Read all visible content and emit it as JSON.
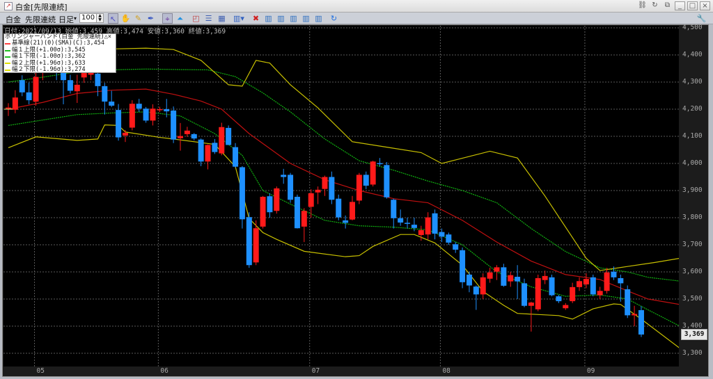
{
  "window": {
    "title": "白金[先限連続]"
  },
  "toolbar": {
    "commodity": "白金",
    "contract": "先限連続",
    "period": "日足",
    "period_arrow": "▾",
    "bar_count": "100"
  },
  "info_line": "日付:2021/09/13 始値:3,459 高値:3,474 安値:3,360 終値:3,369",
  "legend": {
    "title": "ボリンジャーバンド(白金 先限連続)△×",
    "items": [
      {
        "label": "基準線(21)(0)(SMA)(C):3,454",
        "color": "#ff4040"
      },
      {
        "label": "幅１上限(+1.00σ):3,545",
        "color": "#20c020"
      },
      {
        "label": "幅１下限(-1.00σ):3,362",
        "color": "#20c020"
      },
      {
        "label": "幅２上限(+1.96σ):3,633",
        "color": "#e0e000"
      },
      {
        "label": "幅２下限(-1.96σ):3,274",
        "color": "#e0e000"
      }
    ]
  },
  "last_price": "3,369",
  "chart_data": {
    "type": "candlestick",
    "title": "白金[先限連続] 日足",
    "ylim": [
      3250,
      4500
    ],
    "y_ticks": [
      "4,500",
      "4,400",
      "4,300",
      "4,200",
      "4,100",
      "4,000",
      "3,900",
      "3,800",
      "3,700",
      "3,600",
      "3,500",
      "3,400",
      "3,300"
    ],
    "y_tick_values": [
      4500,
      4400,
      4300,
      4200,
      4100,
      4000,
      3900,
      3800,
      3700,
      3600,
      3500,
      3400,
      3300
    ],
    "x_months": [
      {
        "label": "05",
        "index": 4
      },
      {
        "label": "06",
        "index": 22
      },
      {
        "label": "07",
        "index": 44
      },
      {
        "label": "08",
        "index": 63
      },
      {
        "label": "09",
        "index": 84
      }
    ],
    "colors": {
      "up": "#ff1a1a",
      "down": "#1e90ff",
      "mid": "#c01010",
      "band1": "#10b010",
      "band2": "#c8c000"
    },
    "ohlc": [
      [
        4202,
        4222,
        4175,
        4206
      ],
      [
        4198,
        4270,
        4185,
        4243
      ],
      [
        4307,
        4325,
        4248,
        4262
      ],
      [
        4262,
        4298,
        4218,
        4233
      ],
      [
        4228,
        4337,
        4213,
        4319
      ],
      [
        4336,
        4386,
        4307,
        4366
      ],
      [
        4366,
        4405,
        4336,
        4351
      ],
      [
        4351,
        4376,
        4307,
        4336
      ],
      [
        4346,
        4356,
        4218,
        4307
      ],
      [
        4307,
        4327,
        4258,
        4268
      ],
      [
        4266,
        4327,
        4223,
        4290
      ],
      [
        4317,
        4351,
        4297,
        4336
      ],
      [
        4327,
        4341,
        4307,
        4336
      ],
      [
        4331,
        4346,
        4248,
        4285
      ],
      [
        4285,
        4297,
        4180,
        4228
      ],
      [
        4228,
        4268,
        4208,
        4213
      ],
      [
        4197,
        4219,
        4084,
        4096
      ],
      [
        4103,
        4123,
        4079,
        4113
      ],
      [
        4132,
        4233,
        4122,
        4220
      ],
      [
        4220,
        4238,
        4190,
        4202
      ],
      [
        4202,
        4208,
        4150,
        4158
      ],
      [
        4158,
        4218,
        4140,
        4202
      ],
      [
        4197,
        4209,
        4189,
        4200
      ],
      [
        4200,
        4238,
        4170,
        4192
      ],
      [
        4195,
        4210,
        4075,
        4088
      ],
      [
        4093,
        4149,
        4047,
        4101
      ],
      [
        4108,
        4135,
        4098,
        4121
      ],
      [
        4108,
        4112,
        4085,
        4092
      ],
      [
        4088,
        4092,
        3990,
        4007
      ],
      [
        4007,
        4070,
        3978,
        4068
      ],
      [
        4076,
        4090,
        4035,
        4042
      ],
      [
        4037,
        4150,
        4030,
        4134
      ],
      [
        4131,
        4140,
        4068,
        4068
      ],
      [
        4060,
        4075,
        3985,
        3988
      ],
      [
        3986,
        3990,
        3760,
        3794
      ],
      [
        3802,
        3820,
        3615,
        3625
      ],
      [
        3635,
        3790,
        3625,
        3761
      ],
      [
        3767,
        3880,
        3760,
        3877
      ],
      [
        3879,
        3890,
        3800,
        3820
      ],
      [
        3825,
        3915,
        3815,
        3908
      ],
      [
        3958,
        3980,
        3925,
        3950
      ],
      [
        3958,
        3965,
        3855,
        3866
      ],
      [
        3877,
        3885,
        3760,
        3761
      ],
      [
        3767,
        3835,
        3710,
        3825
      ],
      [
        3840,
        3905,
        3800,
        3890
      ],
      [
        3893,
        3915,
        3850,
        3903
      ],
      [
        3906,
        3955,
        3880,
        3950
      ],
      [
        3950,
        3970,
        3850,
        3866
      ],
      [
        3870,
        3885,
        3790,
        3801
      ],
      [
        3790,
        3808,
        3760,
        3781
      ],
      [
        3793,
        3880,
        3790,
        3858
      ],
      [
        3863,
        3965,
        3850,
        3958
      ],
      [
        3958,
        3970,
        3905,
        3918
      ],
      [
        3922,
        4010,
        3915,
        4007
      ],
      [
        4001,
        4020,
        3990,
        4000
      ],
      [
        3994,
        4005,
        3870,
        3875
      ],
      [
        3866,
        3870,
        3760,
        3798
      ],
      [
        3798,
        3830,
        3770,
        3782
      ],
      [
        3781,
        3800,
        3760,
        3780
      ],
      [
        3774,
        3800,
        3750,
        3762
      ],
      [
        3736,
        3770,
        3715,
        3754
      ],
      [
        3738,
        3820,
        3720,
        3801
      ],
      [
        3816,
        3830,
        3720,
        3741
      ],
      [
        3747,
        3760,
        3710,
        3730
      ],
      [
        3738,
        3745,
        3700,
        3708
      ],
      [
        3702,
        3710,
        3670,
        3682
      ],
      [
        3680,
        3690,
        3540,
        3562
      ],
      [
        3590,
        3600,
        3525,
        3550
      ],
      [
        3546,
        3550,
        3460,
        3517
      ],
      [
        3517,
        3595,
        3500,
        3580
      ],
      [
        3575,
        3615,
        3560,
        3598
      ],
      [
        3601,
        3625,
        3570,
        3617
      ],
      [
        3617,
        3630,
        3545,
        3549
      ],
      [
        3565,
        3600,
        3545,
        3588
      ],
      [
        3582,
        3625,
        3500,
        3565
      ],
      [
        3558,
        3575,
        3470,
        3475
      ],
      [
        3475,
        3490,
        3380,
        3487
      ],
      [
        3462,
        3590,
        3455,
        3577
      ],
      [
        3570,
        3605,
        3555,
        3585
      ],
      [
        3580,
        3590,
        3510,
        3514
      ],
      [
        3510,
        3515,
        3485,
        3492
      ],
      [
        3466,
        3485,
        3460,
        3478
      ],
      [
        3492,
        3560,
        3485,
        3544
      ],
      [
        3544,
        3580,
        3530,
        3566
      ],
      [
        3554,
        3595,
        3540,
        3574
      ],
      [
        3580,
        3590,
        3510,
        3517
      ],
      [
        3514,
        3545,
        3500,
        3530
      ],
      [
        3530,
        3615,
        3520,
        3598
      ],
      [
        3601,
        3620,
        3570,
        3580
      ],
      [
        3577,
        3590,
        3490,
        3558
      ],
      [
        3536,
        3550,
        3430,
        3440
      ],
      [
        3440,
        3475,
        3400,
        3445
      ],
      [
        3459,
        3474,
        3360,
        3369
      ]
    ],
    "bands": {
      "mid": [
        [
          0,
          4200
        ],
        [
          5,
          4225
        ],
        [
          10,
          4258
        ],
        [
          15,
          4270
        ],
        [
          20,
          4274
        ],
        [
          24,
          4255
        ],
        [
          28,
          4230
        ],
        [
          31,
          4200
        ],
        [
          35,
          4110
        ],
        [
          41,
          4000
        ],
        [
          46,
          3940
        ],
        [
          51,
          3900
        ],
        [
          56,
          3870
        ],
        [
          61,
          3855
        ],
        [
          66,
          3790
        ],
        [
          71,
          3710
        ],
        [
          76,
          3640
        ],
        [
          81,
          3590
        ],
        [
          86,
          3572
        ],
        [
          90,
          3530
        ],
        [
          93,
          3500
        ],
        [
          98,
          3478
        ]
      ],
      "up1": [
        [
          0,
          4300
        ],
        [
          5,
          4318
        ],
        [
          10,
          4338
        ],
        [
          15,
          4345
        ],
        [
          20,
          4348
        ],
        [
          25,
          4346
        ],
        [
          29,
          4345
        ],
        [
          33,
          4320
        ],
        [
          37,
          4260
        ],
        [
          41,
          4190
        ],
        [
          46,
          4090
        ],
        [
          51,
          4010
        ],
        [
          56,
          3975
        ],
        [
          61,
          3935
        ],
        [
          66,
          3900
        ],
        [
          71,
          3855
        ],
        [
          76,
          3760
        ],
        [
          81,
          3675
        ],
        [
          86,
          3615
        ],
        [
          90,
          3600
        ],
        [
          93,
          3580
        ],
        [
          98,
          3565
        ]
      ],
      "lo1": [
        [
          0,
          4140
        ],
        [
          5,
          4160
        ],
        [
          10,
          4180
        ],
        [
          15,
          4186
        ],
        [
          20,
          4190
        ],
        [
          25,
          4175
        ],
        [
          30,
          4110
        ],
        [
          34,
          4030
        ],
        [
          37,
          3900
        ],
        [
          41,
          3850
        ],
        [
          46,
          3790
        ],
        [
          51,
          3770
        ],
        [
          56,
          3765
        ],
        [
          61,
          3755
        ],
        [
          66,
          3700
        ],
        [
          71,
          3600
        ],
        [
          76,
          3545
        ],
        [
          81,
          3510
        ],
        [
          86,
          3515
        ],
        [
          90,
          3500
        ],
        [
          93,
          3460
        ],
        [
          98,
          3395
        ]
      ],
      "up2": [
        [
          0,
          4390
        ],
        [
          5,
          4405
        ],
        [
          10,
          4415
        ],
        [
          15,
          4422
        ],
        [
          20,
          4425
        ],
        [
          24,
          4420
        ],
        [
          28,
          4380
        ],
        [
          32,
          4290
        ],
        [
          34,
          4285
        ],
        [
          36,
          4380
        ],
        [
          38,
          4370
        ],
        [
          41,
          4290
        ],
        [
          45,
          4205
        ],
        [
          50,
          4080
        ],
        [
          55,
          4060
        ],
        [
          60,
          4040
        ],
        [
          63,
          4000
        ],
        [
          70,
          4045
        ],
        [
          74,
          4020
        ],
        [
          78,
          3880
        ],
        [
          84,
          3650
        ],
        [
          86,
          3605
        ],
        [
          90,
          3620
        ],
        [
          94,
          3635
        ],
        [
          98,
          3652
        ]
      ],
      "lo2": [
        [
          0,
          4058
        ],
        [
          4,
          4098
        ],
        [
          10,
          4085
        ],
        [
          13,
          4090
        ],
        [
          14,
          4142
        ],
        [
          16,
          4140
        ],
        [
          17,
          4116
        ],
        [
          22,
          4096
        ],
        [
          24,
          4090
        ],
        [
          30,
          4070
        ],
        [
          33,
          3988
        ],
        [
          35,
          3797
        ],
        [
          37,
          3745
        ],
        [
          39,
          3720
        ],
        [
          43,
          3676
        ],
        [
          49,
          3656
        ],
        [
          51,
          3660
        ],
        [
          53,
          3694
        ],
        [
          57,
          3738
        ],
        [
          59,
          3738
        ],
        [
          62,
          3707
        ],
        [
          66,
          3625
        ],
        [
          69,
          3528
        ],
        [
          72,
          3477
        ],
        [
          74,
          3447
        ],
        [
          80,
          3439
        ],
        [
          82,
          3426
        ],
        [
          85,
          3464
        ],
        [
          88,
          3482
        ],
        [
          89,
          3480
        ],
        [
          92,
          3426
        ],
        [
          98,
          3311
        ]
      ]
    }
  }
}
